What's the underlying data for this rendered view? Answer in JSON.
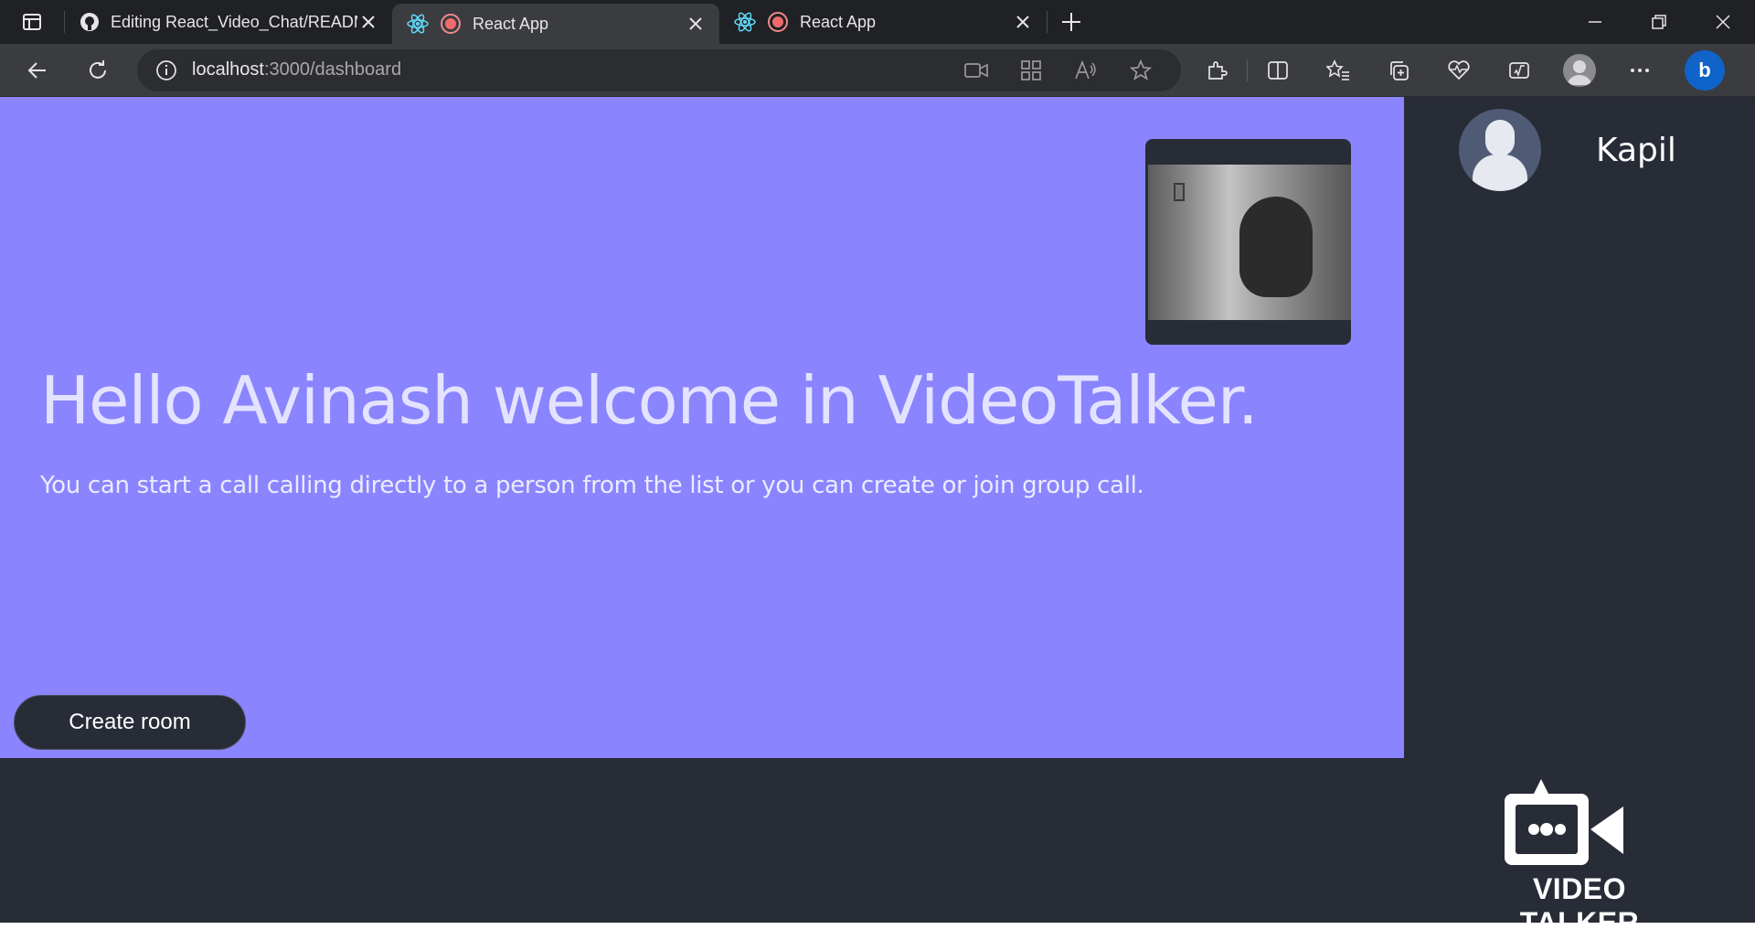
{
  "browser": {
    "tabs": [
      {
        "title": "Editing React_Video_Chat/READM",
        "icon": "github-icon",
        "active": false
      },
      {
        "title": "React App",
        "icon": "react-icon",
        "active": true
      },
      {
        "title": "React App",
        "icon": "react-icon",
        "active": false
      }
    ],
    "address": {
      "host": "localhost",
      "rest": ":3000/dashboard"
    }
  },
  "app": {
    "welcome_title": "Hello Avinash welcome in VideoTalker.",
    "welcome_subtitle": "You can start a call calling directly to a person from the list or you can create or join group call.",
    "create_room_label": "Create room",
    "users": [
      {
        "name": "Kapil"
      }
    ],
    "logo_text": "VIDEO TALKER"
  },
  "colors": {
    "main_bg": "#8a84ff",
    "dark_bg": "#282c37",
    "chrome_bg": "#202124"
  }
}
